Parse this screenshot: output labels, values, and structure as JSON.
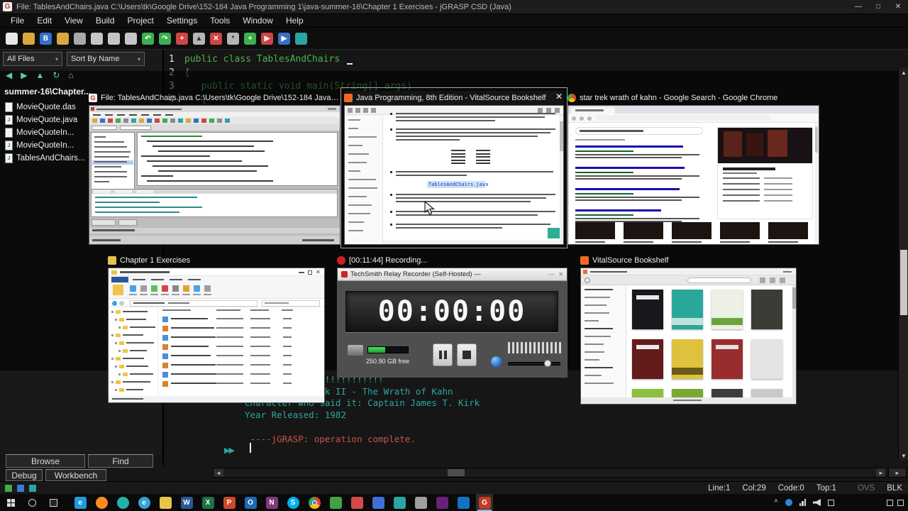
{
  "titlebar": {
    "title": "File: TablesAndChairs.java   C:\\Users\\tk\\Google Drive\\152-184 Java Programming 1\\java-summer-16\\Chapter 1 Exercises - jGRASP CSD (Java)",
    "minimize": "—",
    "maximize": "□",
    "close": "✕"
  },
  "menus": [
    "File",
    "Edit",
    "View",
    "Build",
    "Project",
    "Settings",
    "Tools",
    "Window",
    "Help"
  ],
  "toolbar": {
    "icons": [
      {
        "n": "new-file-icon",
        "c": "#e8e8e8",
        "t": "",
        "f": "#333"
      },
      {
        "n": "open-file-icon",
        "c": "#d9a83c",
        "t": ""
      },
      {
        "n": "save-icon",
        "c": "#3570c8",
        "t": "B"
      },
      {
        "n": "open-folder-icon",
        "c": "#d9a83c",
        "t": ""
      },
      {
        "n": "print-icon",
        "c": "#a9a9a9",
        "t": ""
      },
      {
        "n": "copy-icon",
        "c": "#c6c6c6",
        "t": ""
      },
      {
        "n": "paste-icon",
        "c": "#c6c6c6",
        "t": ""
      },
      {
        "n": "cut-icon",
        "c": "#c6c6c6",
        "t": "",
        "f": "#333"
      },
      {
        "n": "undo-icon",
        "c": "#3fae4f",
        "t": "↶"
      },
      {
        "n": "redo-icon",
        "c": "#3fae4f",
        "t": "↷"
      },
      {
        "n": "add-icon",
        "c": "#cf4545",
        "t": "+"
      },
      {
        "n": "up-icon",
        "c": "#b5b5b5",
        "t": "▲",
        "f": "#333"
      },
      {
        "n": "delete-icon",
        "c": "#cf4545",
        "t": "✕"
      },
      {
        "n": "settings-icon",
        "c": "#b5b5b5",
        "t": "*",
        "f": "#333"
      },
      {
        "n": "compile-icon",
        "c": "#3fae4f",
        "t": "+"
      },
      {
        "n": "run-icon",
        "c": "#cf4545",
        "t": "▶"
      },
      {
        "n": "debug-icon",
        "c": "#3570c8",
        "t": "▶"
      },
      {
        "n": "messages-icon",
        "c": "#2aa4a4",
        "t": ""
      }
    ]
  },
  "filePanel": {
    "filter": "All Files",
    "sort": "Sort By Name",
    "path": "summer-16\\Chapter...",
    "nav_icons": [
      {
        "n": "back-icon",
        "g": "◀"
      },
      {
        "n": "forward-icon",
        "g": "▶"
      },
      {
        "n": "up-icon",
        "g": "▲"
      },
      {
        "n": "refresh-icon",
        "g": "↻"
      },
      {
        "n": "home-icon",
        "g": "⌂"
      }
    ],
    "files": [
      {
        "name": "MovieQuote.das",
        "kind": "class"
      },
      {
        "name": "MovieQuote.java",
        "kind": "java"
      },
      {
        "name": "MovieQuoteIn...",
        "kind": "class"
      },
      {
        "name": "MovieQuoteIn...",
        "kind": "java"
      },
      {
        "name": "TablesAndChairs...",
        "kind": "java"
      }
    ]
  },
  "editor": {
    "lines": [
      {
        "n": "1",
        "t": "public class TablesAndChairs"
      },
      {
        "n": "2",
        "t": "{"
      },
      {
        "n": "3",
        "t": "   public static void main(String[] args)"
      },
      {
        "n": "4",
        "t": "   {"
      }
    ]
  },
  "console": {
    "lines": [
      "vie Quote: Kahn!!!!!!!!!!!",
      "Movie: Star Trek II - The Wrath of Kahn",
      "Character who said it: Captain James T. Kirk",
      "Year Released: 1982"
    ],
    "status": " ----jGRASP: operation complete.",
    "prompt": "▶▶"
  },
  "panes": {
    "browse": "Browse",
    "find": "Find",
    "debug": "Debug",
    "workbench": "Workbench"
  },
  "statusbar": {
    "line": "Line:1",
    "col": "Col:29",
    "code": "Code:0",
    "top": "Top:1",
    "ovs": "OVS",
    "blk": "BLK"
  },
  "glyphs": {
    "left_arrow": "◄",
    "right_arrow": "►",
    "up_arrow": "▲",
    "down_arrow": "▼",
    "menu_arrow": "▾",
    "caret": "^"
  },
  "altTab": {
    "close_glyph": "✕",
    "thumbnails": [
      {
        "title": "File: TablesAndChairs.java  C:\\Users\\tk\\Google Drive\\152-184 Java Prog..."
      },
      {
        "title": "Java Programming,  8th Edition - VitalSource Bookshelf",
        "selected": true
      },
      {
        "title": "star trek wrath of kahn - Google Search - Google Chrome"
      },
      {
        "title": "Chapter 1 Exercises"
      },
      {
        "title": "[00:11:44] Recording..."
      },
      {
        "title": "VitalSource Bookshelf"
      }
    ]
  },
  "recorder": {
    "window_title": "TechSmith Relay Recorder (Self-Hosted) —",
    "timer": "00:00:00",
    "disk_free": "250.90 GB free"
  },
  "book": {
    "link": "TablesAndChairs.java"
  },
  "bookshelf": {
    "covers": [
      {
        "c": "#17171c",
        "top": "#e8e8e8"
      },
      {
        "c": "#2aa79b",
        "band": "#bfe3da"
      },
      {
        "c": "#edf0e4",
        "band": "#6aa43f"
      },
      {
        "c": "#3a3d36"
      },
      {
        "c": "#641b1b",
        "top": "#e8e8e8"
      },
      {
        "c": "#dec23e",
        "band": "#6b5a18"
      },
      {
        "c": "#992c2c",
        "top": "#e0e0e0"
      },
      {
        "c": "#e4e4e4"
      },
      {
        "c": "#8fbf3f"
      },
      {
        "c": "#7aa832"
      },
      {
        "c": "#3c3c3c"
      },
      {
        "c": "#c9c9c9"
      }
    ]
  },
  "taskbar": {
    "apps": [
      {
        "name": "edge",
        "c": "#1e9be0",
        "t": "e"
      },
      {
        "name": "firefox",
        "c": "#ff8a1e",
        "t": "",
        "round": true
      },
      {
        "name": "app-teal",
        "c": "#28b0a8",
        "t": "",
        "round": true
      },
      {
        "name": "internet-explorer",
        "c": "#3aa0da",
        "t": "e",
        "round": true
      },
      {
        "name": "file-explorer",
        "c": "#e8c34a",
        "t": ""
      },
      {
        "name": "word",
        "c": "#2b579a",
        "t": "W"
      },
      {
        "name": "excel",
        "c": "#1e7145",
        "t": "X"
      },
      {
        "name": "powerpoint",
        "c": "#d04727",
        "t": "P"
      },
      {
        "name": "outlook",
        "c": "#1c6bb4",
        "t": "O"
      },
      {
        "name": "onenote",
        "c": "#80397b",
        "t": "N"
      },
      {
        "name": "skype",
        "c": "#00aff0",
        "t": "S",
        "round": true
      },
      {
        "name": "chrome",
        "c": "chrome",
        "t": ""
      },
      {
        "name": "app-green",
        "c": "#43a047",
        "t": ""
      },
      {
        "name": "app-red",
        "c": "#d34a4a",
        "t": ""
      },
      {
        "name": "app-blue",
        "c": "#3f6fd8",
        "t": ""
      },
      {
        "name": "app-teal-2",
        "c": "#2aa4a4",
        "t": ""
      },
      {
        "name": "app-gray",
        "c": "#9e9e9e",
        "t": ""
      },
      {
        "name": "visual-studio",
        "c": "#68217a",
        "t": ""
      },
      {
        "name": "store",
        "c": "#1273c4",
        "t": ""
      },
      {
        "name": "jgrasp",
        "c": "#c23b22",
        "t": "G",
        "active": true
      }
    ]
  },
  "colors": {
    "code_green": "#4db34d",
    "console_teal": "#2fa3a3",
    "error_red": "#c65548",
    "taskbar_accent": "#76b9ed",
    "recorder_disk_green": "#2fd04f",
    "link_blue": "#1a0dab",
    "vitalsource_orange": "#f26a21"
  }
}
